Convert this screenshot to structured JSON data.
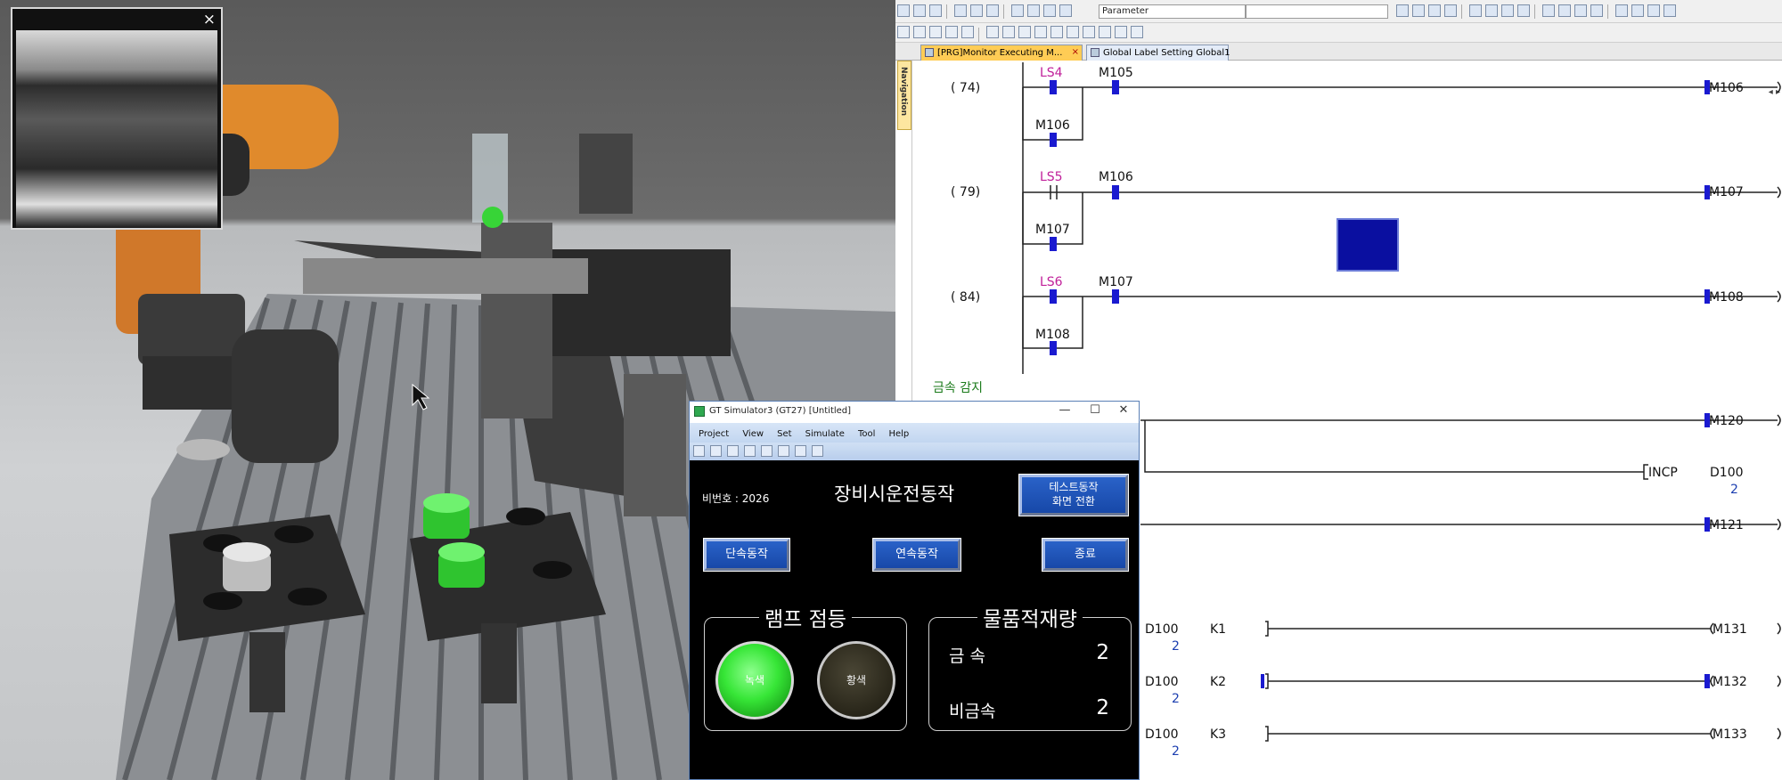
{
  "camera_pip": {
    "close_label": "×"
  },
  "gxworks": {
    "toolbar": {
      "parameter_combo": "Parameter"
    },
    "tabs": [
      {
        "label": "[PRG]Monitor Executing M...",
        "close": "×"
      },
      {
        "label": "Global Label Setting Global1"
      }
    ],
    "tab_scroll": "◂ ▸",
    "navigation_label": "Navigation",
    "section_label": "금속 감지",
    "rungs": [
      {
        "step": "(   74)",
        "contact": "LS4",
        "contact2": "M105",
        "branch": "M106",
        "coil": "M106"
      },
      {
        "step": "(   79)",
        "contact": "LS5",
        "contact2": "M106",
        "branch": "M107",
        "coil": "M107"
      },
      {
        "step": "(   84)",
        "contact": "LS6",
        "contact2": "M107",
        "branch": "M108",
        "coil": "M108"
      }
    ],
    "lower_coils": [
      "M120",
      "M121"
    ],
    "incp": {
      "instr": "INCP",
      "operand": "D100",
      "value": "2"
    },
    "compares": [
      {
        "dev": "D100",
        "val": "2",
        "k": "K1",
        "coil": "M131"
      },
      {
        "dev": "D100",
        "val": "2",
        "k": "K2",
        "coil": "M132"
      },
      {
        "dev": "D100",
        "val": "2",
        "k": "K3",
        "coil": "M133"
      }
    ]
  },
  "gt_simulator": {
    "title": "GT Simulator3 (GT27)  [Untitled]",
    "window_buttons": {
      "minimize": "—",
      "maximize": "☐",
      "close": "✕"
    },
    "menu": [
      "Project",
      "View",
      "Set",
      "Simulate",
      "Tool",
      "Help"
    ],
    "screen": {
      "device_no": "비번호 : 2026",
      "heading": "장비시운전동작",
      "test_button_line1": "테스트동작",
      "test_button_line2": "화면 전환",
      "single_button": "단속동작",
      "continuous_button": "연속동작",
      "stop_button": "종료",
      "lamp_title": "램프 점등",
      "lamp_green_label": "녹색",
      "lamp_yellow_label": "황색",
      "count_title": "물품적재량",
      "metal_label": "금 속",
      "metal_value": "2",
      "nonmetal_label": "비금속",
      "nonmetal_value": "2"
    }
  }
}
